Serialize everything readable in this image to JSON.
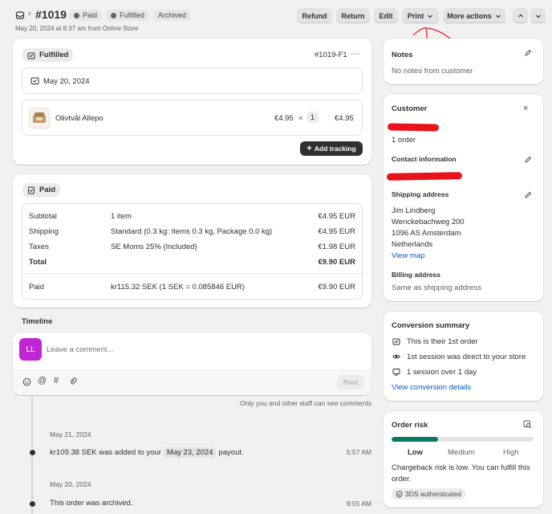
{
  "header": {
    "order_number": "#1019",
    "badges": [
      "Paid",
      "Fulfilled",
      "Archived"
    ],
    "subtitle": "May 20, 2024 at 8:37 am from Online Store",
    "buttons": {
      "refund": "Refund",
      "return": "Return",
      "edit": "Edit",
      "print": "Print",
      "more": "More actions"
    }
  },
  "fulfilled_card": {
    "status": "Fulfilled",
    "fulfillment_id": "#1019-F1",
    "date": "May 20, 2024",
    "item": {
      "name": "Olivtvål Allepo",
      "price": "€4.95",
      "times": "×",
      "qty": "1",
      "total": "€4.95"
    },
    "add_tracking": "Add tracking"
  },
  "paid_card": {
    "status": "Paid",
    "rows": [
      {
        "label": "Subtotal",
        "desc": "1 item",
        "value": "€4.95 EUR"
      },
      {
        "label": "Shipping",
        "desc": "Standard (0.3 kg: Items 0.3 kg, Package 0.0 kg)",
        "value": "€4.95 EUR"
      },
      {
        "label": "Taxes",
        "desc": "SE Moms 25% (Included)",
        "value": "€1.98 EUR"
      },
      {
        "label": "Total",
        "desc": "",
        "value": "€9.90 EUR"
      }
    ],
    "paid_row": {
      "label": "Paid",
      "desc": "kr115.32 SEK (1 SEK = 0.085846 EUR)",
      "value": "€9.90 EUR"
    }
  },
  "timeline": {
    "heading": "Timeline",
    "avatar_initials": "LL",
    "comment_placeholder": "Leave a comment...",
    "post": "Post",
    "staff_note": "Only you and other staff can see comments",
    "events": [
      {
        "date": "May 21, 2024",
        "text_before": "kr109.38 SEK was added to your",
        "chip": "May 23, 2024",
        "text_after": "payout.",
        "time": "5:57 AM"
      },
      {
        "date": "May 20, 2024",
        "text": "This order was archived.",
        "time": "9:55 AM"
      }
    ]
  },
  "notes": {
    "title": "Notes",
    "text": "No notes from customer"
  },
  "customer": {
    "title": "Customer",
    "orders": "1 order",
    "contact_title": "Contact information",
    "shipping_title": "Shipping address",
    "address": [
      "Jim Lindberg",
      "Wenckebachweg 200",
      "1096 AS Amsterdam",
      "Netherlands"
    ],
    "view_map": "View map",
    "billing_title": "Billing address",
    "billing_text": "Same as shipping address"
  },
  "conversion": {
    "title": "Conversion summary",
    "items": [
      "This is their 1st order",
      "1st session was direct to your store",
      "1 session over 1 day"
    ],
    "link": "View conversion details"
  },
  "risk": {
    "title": "Order risk",
    "level_fraction": 0.33,
    "labels": [
      "Low",
      "Medium",
      "High"
    ],
    "text": "Chargeback risk is low. You can fulfill this order.",
    "badge": "3DS authenticated"
  },
  "colors": {
    "accent_green": "#047b5d",
    "redaction": "#e8141c",
    "annotation": "#e8141c"
  }
}
